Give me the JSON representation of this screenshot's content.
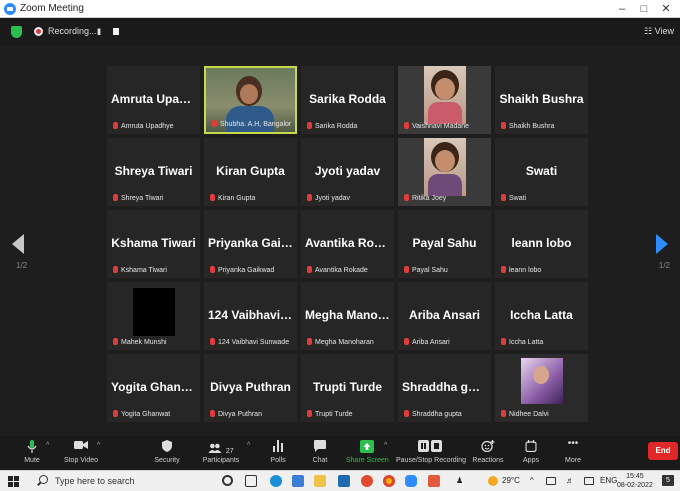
{
  "window": {
    "title": "Zoom Meeting",
    "min": "–",
    "max": "□",
    "close": "✕"
  },
  "meeting_bar": {
    "recording_label": "Recording...",
    "pause_glyph": "II",
    "view_label": "☷ View"
  },
  "pagination": {
    "left_page": "1/2",
    "right_page": "1/2"
  },
  "tiles": [
    {
      "big": "Amruta Upadhye",
      "small": "Amruta Upadhye"
    },
    {
      "big": "",
      "small": "Shubha. A.H, Bangalore",
      "video": "person-a"
    },
    {
      "big": "Sarika Rodda",
      "small": "Sarika Rodda"
    },
    {
      "big": "",
      "small": "Vaishnavi Madane",
      "video": "person-b"
    },
    {
      "big": "Shaikh Bushra",
      "small": "Shaikh Bushra"
    },
    {
      "big": "Shreya Tiwari",
      "small": "Shreya Tiwari"
    },
    {
      "big": "Kiran Gupta",
      "small": "Kiran Gupta"
    },
    {
      "big": "Jyoti yadav",
      "small": "Jyoti yadav"
    },
    {
      "big": "",
      "small": "Ritika Joey",
      "video": "person-c"
    },
    {
      "big": "Swati",
      "small": "Swati"
    },
    {
      "big": "Kshama Tiwari",
      "small": "Kshama Tiwari"
    },
    {
      "big": "Priyanka Gaikwad",
      "small": "Priyanka Gaikwad"
    },
    {
      "big": "Avantika Rokade",
      "small": "Avantika Rokade"
    },
    {
      "big": "Payal Sahu",
      "small": "Payal Sahu"
    },
    {
      "big": "leann lobo",
      "small": "leann lobo"
    },
    {
      "big": "",
      "small": "Mahek Munshi",
      "video": "black"
    },
    {
      "big": "124 Vaibhavi Su...",
      "small": "124 Vaibhavi Sunwade"
    },
    {
      "big": "Megha Manoha...",
      "small": "Megha Manoharan"
    },
    {
      "big": "Ariba Ansari",
      "small": "Ariba Ansari"
    },
    {
      "big": "Iccha Latta",
      "small": "Iccha Latta"
    },
    {
      "big": "Yogita Ghanwat",
      "small": "Yogita Ghanwat"
    },
    {
      "big": "Divya Puthran",
      "small": "Divya Puthran"
    },
    {
      "big": "Trupti Turde",
      "small": "Trupti Turde"
    },
    {
      "big": "Shraddha gupta",
      "small": "Shraddha gupta"
    },
    {
      "big": "",
      "small": "Nidhee Dalvi",
      "video": "person-d"
    }
  ],
  "toolbar": {
    "mute": "Mute",
    "stop_video": "Stop Video",
    "security": "Security",
    "participants": "Participants",
    "participants_count": "27",
    "polls": "Polls",
    "chat": "Chat",
    "share_screen": "Share Screen",
    "recording": "Pause/Stop Recording",
    "reactions": "Reactions",
    "apps": "Apps",
    "more": "More",
    "end": "End",
    "caret": "^"
  },
  "taskbar": {
    "search_placeholder": "Type here to search",
    "temperature": "29°C",
    "language": "ENG",
    "time": "15:45",
    "date": "08-02-2022",
    "notification_count": "5"
  },
  "colors": {
    "accent": "#2d8cff",
    "active_speaker": "#c8d94a",
    "end_button": "#e02828",
    "share_green": "#2bbf4f",
    "muted_red": "#e23b3b"
  }
}
